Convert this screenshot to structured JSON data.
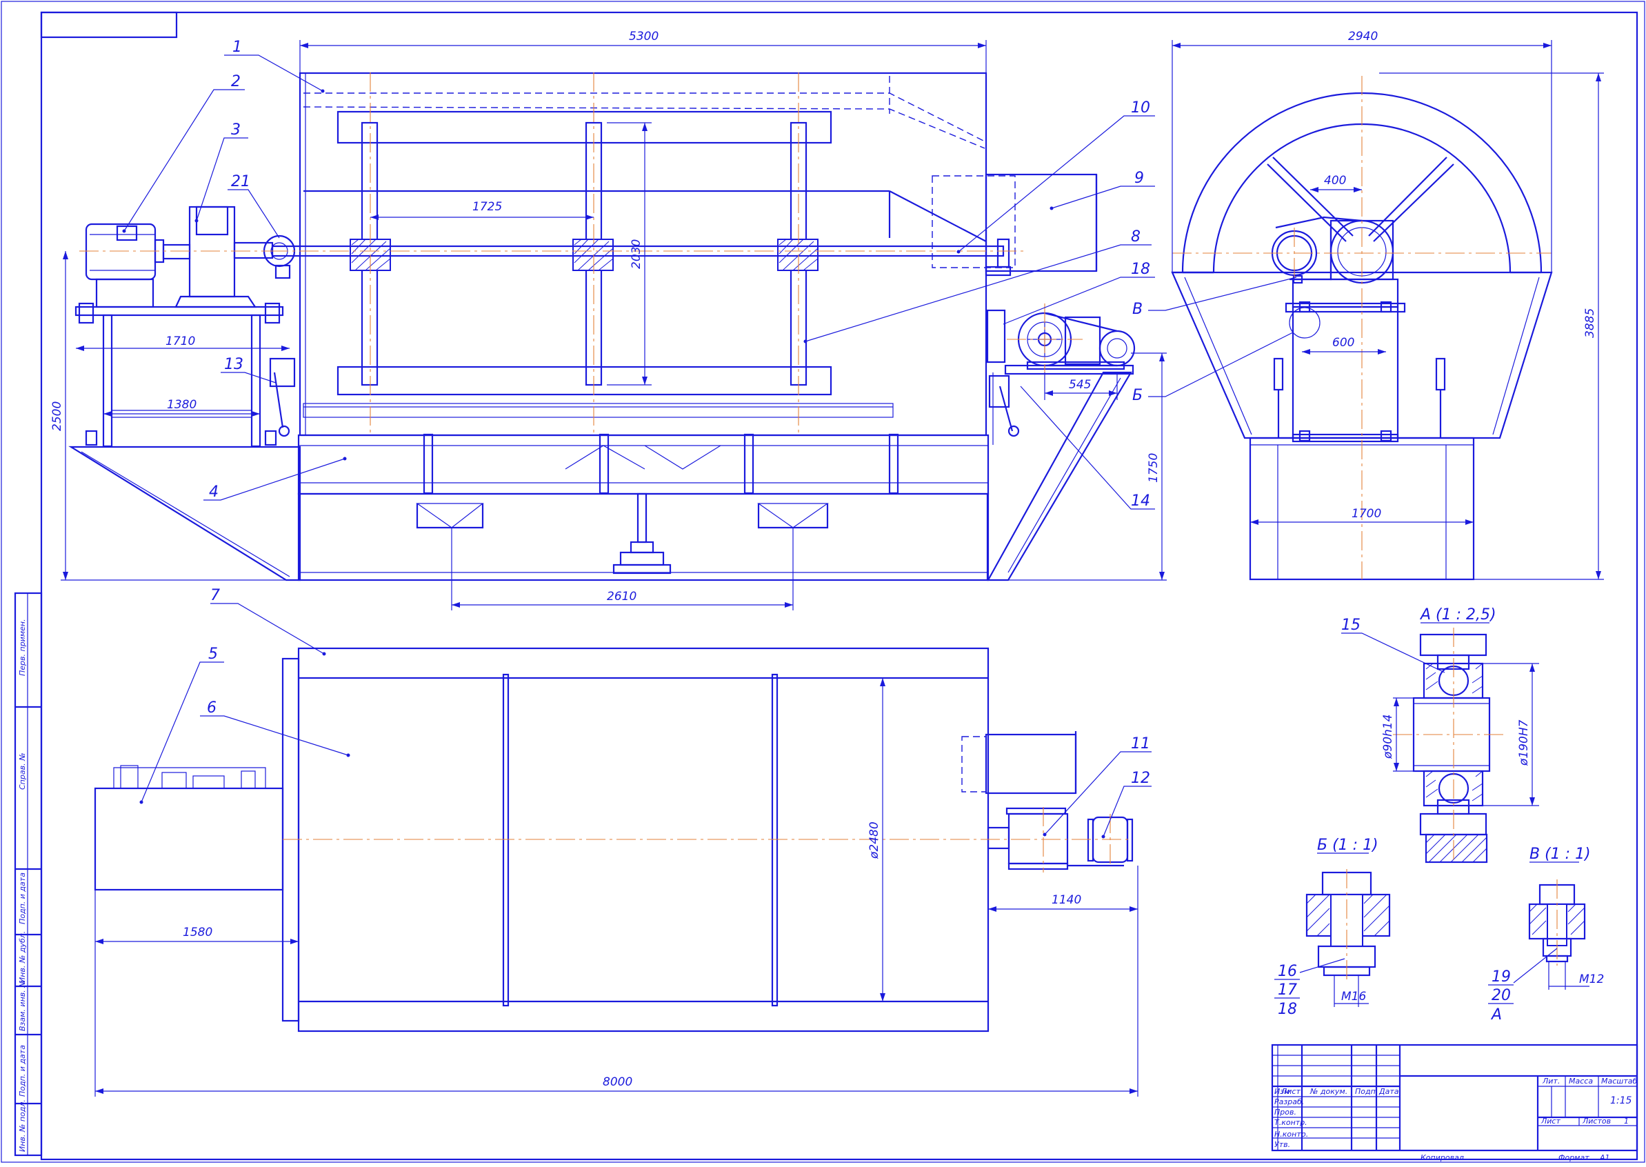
{
  "dimensions": {
    "side_length": "5300",
    "side_height": "2500",
    "frame_length": "1710",
    "frame_inner": "1380",
    "paddle_pitch": "1725",
    "paddle_height": "2030",
    "support_pitch": "2610",
    "drive_offset": "545",
    "right_height": "1750",
    "end_width": "2940",
    "end_height": "3885",
    "hub_width": "400",
    "stand_width": "600",
    "base_width": "1700",
    "drum_diameter": "ø2480",
    "drive_length": "1140",
    "motor_length": "1580",
    "overall_length": "8000",
    "shaft_fit": "ø90h14",
    "housing_fit": "ø190H7",
    "bolt_b": "M16",
    "bolt_v": "M12"
  },
  "callouts": [
    "1",
    "2",
    "3",
    "4",
    "5",
    "6",
    "7",
    "8",
    "9",
    "10",
    "11",
    "12",
    "13",
    "14",
    "15",
    "16",
    "17",
    "18",
    "19",
    "20",
    "21",
    "А",
    "Б",
    "В",
    "18"
  ],
  "detail_views": {
    "a": "А (1 : 2,5)",
    "b": "Б (1 : 1)",
    "v": "В (1 : 1)"
  },
  "title_block": {
    "col_izm": "Изм",
    "col_list": "Лист",
    "col_doc": "№ докум.",
    "col_sign": "Подп.",
    "col_date": "Дата",
    "row_razrab": "Разраб.",
    "row_prov": "Пров.",
    "row_tkontr": "Т.контр.",
    "row_nkontr": "Н.контр.",
    "row_utv": "Утв.",
    "lit": "Лит.",
    "massa": "Масса",
    "masshtab": "Масштаб",
    "scale": "1:15",
    "sheet": "Лист",
    "sheets": "Листов",
    "sheets_count": "1",
    "copied": "Копировал",
    "format_label": "Формат",
    "format": "A1"
  },
  "side_stamp": [
    "Перв. примен.",
    "Справ. №",
    "Подп. и дата",
    "Инв. № дубл.",
    "Взам. инв. №",
    "Подп. и дата",
    "Инв. № подл."
  ],
  "colors": {
    "line": "#1a1adc",
    "axis": "#e3823a",
    "background": "#ffffff"
  }
}
